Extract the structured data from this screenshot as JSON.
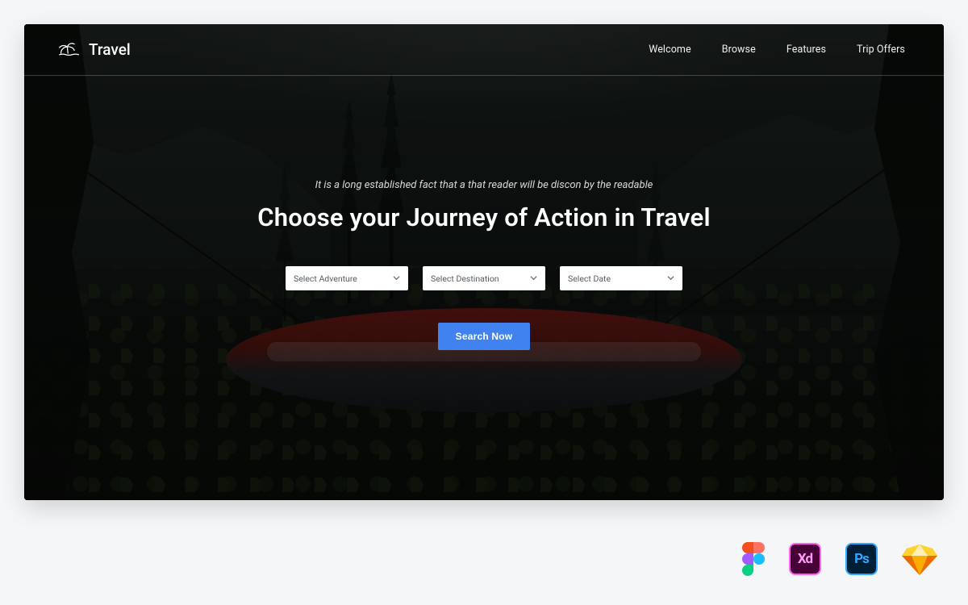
{
  "brand": {
    "name": "Travel"
  },
  "nav": {
    "items": [
      {
        "label": "Welcome"
      },
      {
        "label": "Browse"
      },
      {
        "label": "Features"
      },
      {
        "label": "Trip Offers"
      }
    ]
  },
  "hero": {
    "tagline": "It is a long established fact that a that reader will be discon by the readable",
    "headline": "Choose your Journey of Action in Travel",
    "selects": [
      {
        "placeholder": "Select Adventure"
      },
      {
        "placeholder": "Select Destination"
      },
      {
        "placeholder": "Select Date"
      }
    ],
    "search_label": "Search Now"
  },
  "tools": {
    "xd_label": "Xd",
    "ps_label": "Ps"
  }
}
